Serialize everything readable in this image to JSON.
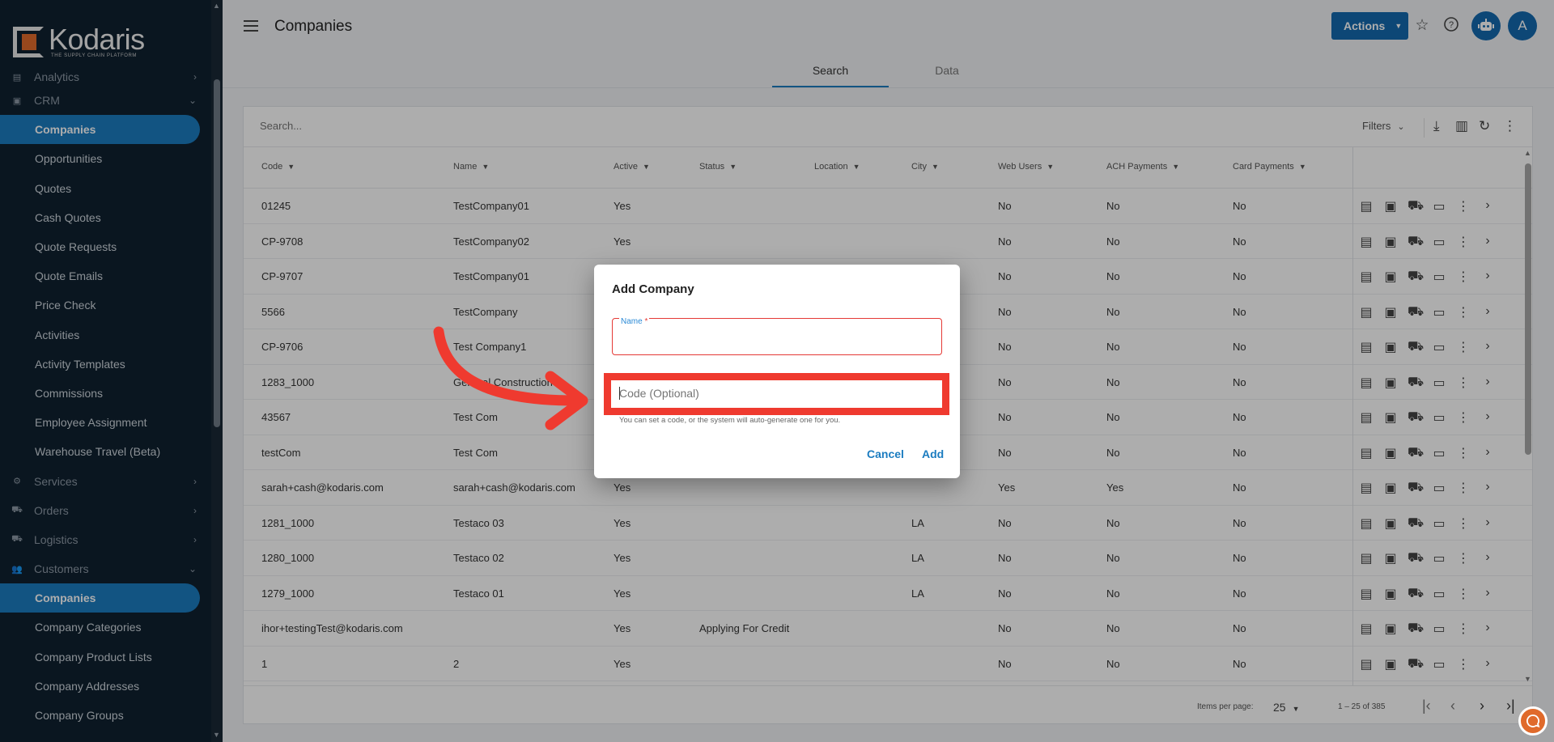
{
  "app": {
    "logo_name": "Kodaris",
    "logo_tagline": "THE SUPPLY CHAIN PLATFORM"
  },
  "sidebar": {
    "items": [
      {
        "label": "Analytics",
        "type": "section",
        "icon": "chart-icon",
        "chevron": "›",
        "partial": true
      },
      {
        "label": "CRM",
        "type": "section",
        "icon": "briefcase-icon",
        "chevron": "⌄"
      },
      {
        "label": "Companies",
        "type": "child",
        "active": true
      },
      {
        "label": "Opportunities",
        "type": "child"
      },
      {
        "label": "Quotes",
        "type": "child"
      },
      {
        "label": "Cash Quotes",
        "type": "child"
      },
      {
        "label": "Quote Requests",
        "type": "child"
      },
      {
        "label": "Quote Emails",
        "type": "child"
      },
      {
        "label": "Price Check",
        "type": "child"
      },
      {
        "label": "Activities",
        "type": "child"
      },
      {
        "label": "Activity Templates",
        "type": "child"
      },
      {
        "label": "Commissions",
        "type": "child"
      },
      {
        "label": "Employee Assignment",
        "type": "child"
      },
      {
        "label": "Warehouse Travel (Beta)",
        "type": "child"
      },
      {
        "label": "Services",
        "type": "section",
        "icon": "gears-icon",
        "chevron": "›"
      },
      {
        "label": "Orders",
        "type": "section",
        "icon": "truck-icon",
        "chevron": "›"
      },
      {
        "label": "Logistics",
        "type": "section",
        "icon": "delivery-icon",
        "chevron": "›"
      },
      {
        "label": "Customers",
        "type": "section",
        "icon": "people-icon",
        "chevron": "⌄"
      },
      {
        "label": "Companies",
        "type": "child",
        "active": true
      },
      {
        "label": "Company Categories",
        "type": "child"
      },
      {
        "label": "Company Product Lists",
        "type": "child"
      },
      {
        "label": "Company Addresses",
        "type": "child"
      },
      {
        "label": "Company Groups",
        "type": "child"
      }
    ]
  },
  "header": {
    "title": "Companies",
    "actions_label": "Actions",
    "avatar_initial": "A",
    "tabs": [
      {
        "label": "Search",
        "active": true
      },
      {
        "label": "Data",
        "active": false
      }
    ]
  },
  "table": {
    "search_placeholder": "Search...",
    "filters_label": "Filters",
    "columns": [
      "Code",
      "Name",
      "Active",
      "Status",
      "Location",
      "City",
      "Web Users",
      "ACH Payments",
      "Card Payments"
    ],
    "rows": [
      [
        "01245",
        "TestCompany01",
        "Yes",
        "",
        "",
        "",
        "No",
        "No",
        "No"
      ],
      [
        "CP-9708",
        "TestCompany02",
        "Yes",
        "",
        "",
        "",
        "No",
        "No",
        "No"
      ],
      [
        "CP-9707",
        "TestCompany01",
        "",
        "",
        "",
        "",
        "No",
        "No",
        "No"
      ],
      [
        "5566",
        "TestCompany",
        "",
        "",
        "",
        "",
        "No",
        "No",
        "No"
      ],
      [
        "CP-9706",
        "Test Company1",
        "",
        "",
        "",
        "",
        "No",
        "No",
        "No"
      ],
      [
        "1283_1000",
        "General Construction",
        "",
        "",
        "",
        "",
        "No",
        "No",
        "No"
      ],
      [
        "43567",
        "Test Com",
        "",
        "",
        "",
        "",
        "No",
        "No",
        "No"
      ],
      [
        "testCom",
        "Test Com",
        "",
        "",
        "",
        "",
        "No",
        "No",
        "No"
      ],
      [
        "sarah+cash@kodaris.com",
        "sarah+cash@kodaris.com",
        "Yes",
        "",
        "",
        "",
        "Yes",
        "Yes",
        "No"
      ],
      [
        "1281_1000",
        "Testaco 03",
        "Yes",
        "",
        "",
        "LA",
        "No",
        "No",
        "No"
      ],
      [
        "1280_1000",
        "Testaco 02",
        "Yes",
        "",
        "",
        "LA",
        "No",
        "No",
        "No"
      ],
      [
        "1279_1000",
        "Testaco 01",
        "Yes",
        "",
        "",
        "LA",
        "No",
        "No",
        "No"
      ],
      [
        "ihor+testingTest@kodaris.com",
        "",
        "Yes",
        "Applying For Credit",
        "",
        "",
        "No",
        "No",
        "No"
      ],
      [
        "1",
        "2",
        "Yes",
        "",
        "",
        "",
        "No",
        "No",
        "No"
      ]
    ],
    "paginator": {
      "items_per_page_label": "Items per page:",
      "page_size": "25",
      "range_label": "1 – 25 of 385"
    }
  },
  "dialog": {
    "title": "Add Company",
    "name_label": "Name",
    "name_required_mark": "*",
    "name_value": "",
    "code_placeholder": "Code (Optional)",
    "code_hint": "You can set a code, or the system will auto-generate one for you.",
    "cancel_label": "Cancel",
    "add_label": "Add"
  },
  "colors": {
    "sidebar_bg": "#0f2130",
    "accent": "#1b7cc0",
    "primary_button": "#1469ae",
    "highlight": "#ef3a2f",
    "brand_orange": "#e06a2b"
  }
}
